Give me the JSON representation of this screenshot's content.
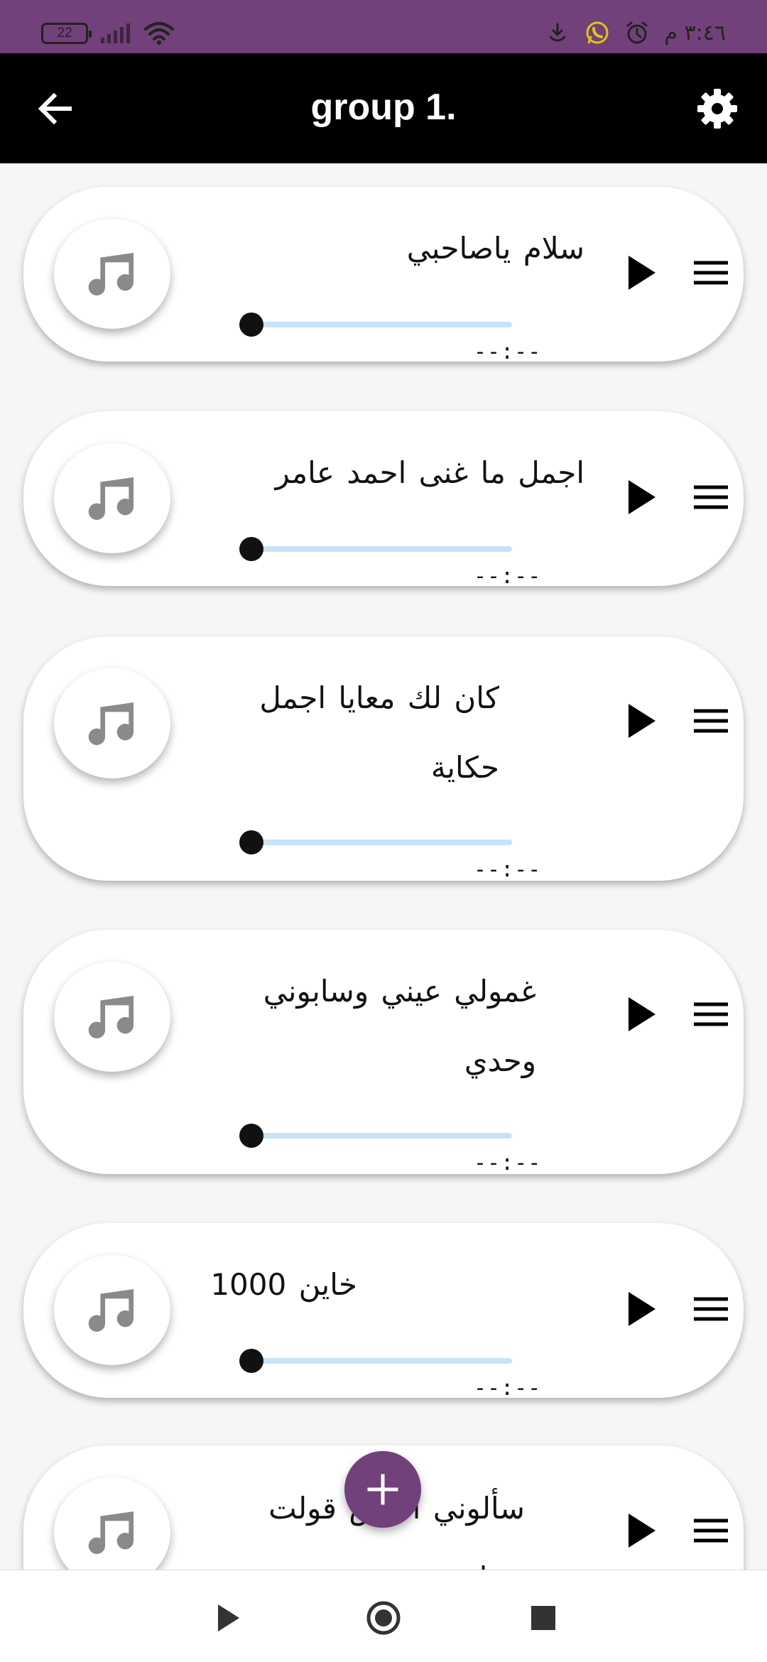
{
  "status_bar": {
    "battery": "22",
    "time": "٣:٤٦ م",
    "background": "#72407a"
  },
  "app_bar": {
    "title": "group 1.",
    "back_icon": "arrow-back-icon",
    "settings_icon": "gear-icon"
  },
  "songs": [
    {
      "title": "سلام ياصاحبي",
      "duration": "--:--",
      "progress": 0
    },
    {
      "title": "اجمل ما غنى احمد عامر",
      "duration": "--:--",
      "progress": 0
    },
    {
      "title_line1": "كان لك معايا اجمل",
      "title_line2": "حكاية",
      "duration": "--:--",
      "progress": 0
    },
    {
      "title_line1": "غمولي عيني وسابوني",
      "title_line2": "وحدي",
      "duration": "--:--",
      "progress": 0
    },
    {
      "title": "خاين 1000",
      "duration": "--:--",
      "progress": 0
    },
    {
      "title_line1": "سألوني الناس قولت",
      "title_line2": "بحبك",
      "duration": "--:--",
      "progress": 0
    }
  ],
  "fab": {
    "icon": "plus-icon",
    "color": "#72407a"
  },
  "bottom_bar": {
    "play_icon": "play-icon",
    "record_icon": "radio-circle-icon",
    "stop_icon": "stop-icon"
  },
  "colors": {
    "accent": "#72407a",
    "slider_track": "#c8e3f7",
    "note_icon": "#8a8a8a"
  }
}
